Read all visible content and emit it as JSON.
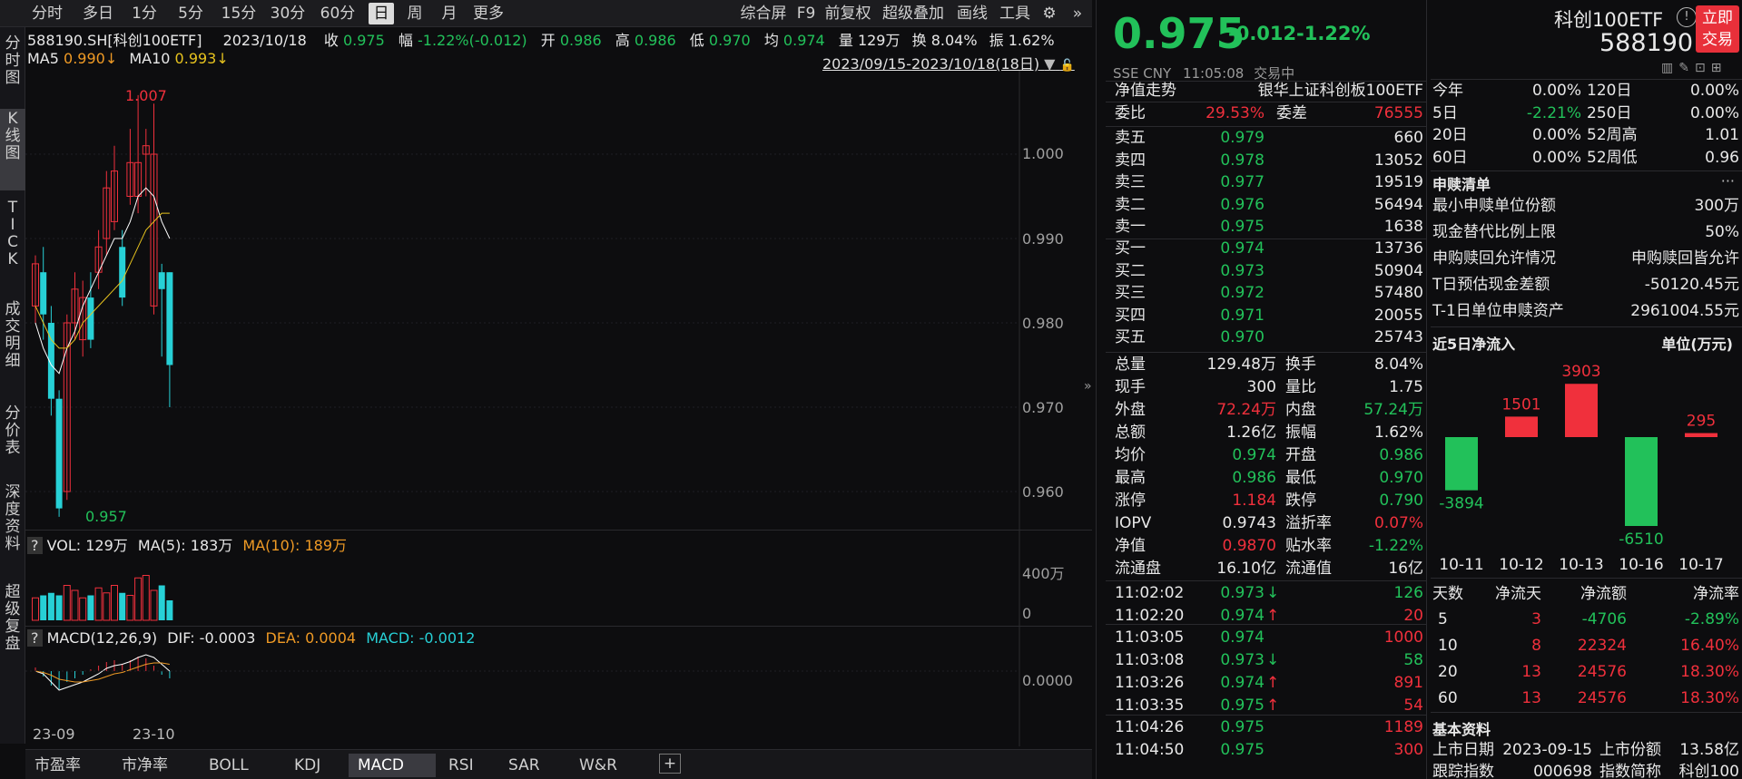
{
  "toolbar": {
    "left": [
      "分时",
      "多日",
      "1分",
      "5分",
      "15分",
      "30分",
      "60分",
      "日",
      "周",
      "月",
      "更多"
    ],
    "active": "日",
    "right": [
      "综合屏",
      "F9",
      "前复权",
      "超级叠加",
      "画线",
      "工具"
    ]
  },
  "sidetabs": [
    "分\n时\n图",
    "K\n线\n图",
    "T\nI\nC\nK",
    "成\n交\n明\n细",
    "分\n价\n表",
    "深\n度\n资\n料",
    "超\n级\n复\n盘"
  ],
  "info": {
    "code": "588190.SH[科创100ETF]",
    "date": "2023/10/18",
    "close_label": "收",
    "close": "0.975",
    "chg_label": "幅",
    "chg": "-1.22%(-0.012)",
    "open_label": "开",
    "open": "0.986",
    "high_label": "高",
    "high": "0.986",
    "low_label": "低",
    "low": "0.970",
    "avg_label": "均",
    "avg": "0.974",
    "vol_label": "量",
    "vol": "129万",
    "turn_label": "换",
    "turn": "8.04%",
    "amp_label": "振",
    "amp": "1.62%"
  },
  "ma": {
    "ma5_label": "MA5",
    "ma5": "0.990↓",
    "ma10_label": "MA10",
    "ma10": "0.993↓",
    "range": "2023/09/15-2023/10/18(18日)"
  },
  "yaxis": [
    "1.000",
    "0.990",
    "0.980",
    "0.970",
    "0.960"
  ],
  "annot": {
    "high": "1.007",
    "low": "0.957"
  },
  "vol": {
    "q": "?",
    "text": "VOL: 129万",
    "ma5": "MA(5): 183万",
    "ma10": "MA(10): 189万",
    "ticks": [
      "400万",
      "0"
    ]
  },
  "macd": {
    "q": "?",
    "title": "MACD(12,26,9)",
    "dif": "DIF: -0.0003",
    "dea": "DEA: 0.0004",
    "macd": "MACD: -0.0012",
    "tick": "0.0000"
  },
  "xaxis": [
    "23-09",
    "23-10"
  ],
  "bottomtabs": [
    "市盈率",
    "市净率",
    "BOLL",
    "KDJ",
    "MACD",
    "RSI",
    "SAR",
    "W&R"
  ],
  "bottom_active": "MACD",
  "quote": {
    "price": "0.975",
    "chg": "-0.012",
    "pct": "-1.22%",
    "name": "科创100ETF",
    "code": "588190",
    "buy_btn": "立即\n交易",
    "market": "SSE CNY",
    "time": "11:05:08",
    "status": "交易中"
  },
  "nav": {
    "label": "净值走势",
    "index": "银华上证科创板100ETF"
  },
  "wei": {
    "wb_label": "委比",
    "wb": "29.53%",
    "wc_label": "委差",
    "wc": "76555"
  },
  "asks": [
    {
      "l": "卖五",
      "p": "0.979",
      "v": "660"
    },
    {
      "l": "卖四",
      "p": "0.978",
      "v": "13052"
    },
    {
      "l": "卖三",
      "p": "0.977",
      "v": "19519"
    },
    {
      "l": "卖二",
      "p": "0.976",
      "v": "56494"
    },
    {
      "l": "卖一",
      "p": "0.975",
      "v": "1638"
    }
  ],
  "bids": [
    {
      "l": "买一",
      "p": "0.974",
      "v": "13736"
    },
    {
      "l": "买二",
      "p": "0.973",
      "v": "50904"
    },
    {
      "l": "买三",
      "p": "0.972",
      "v": "57480"
    },
    {
      "l": "买四",
      "p": "0.971",
      "v": "20055"
    },
    {
      "l": "买五",
      "p": "0.970",
      "v": "25743"
    }
  ],
  "stats": [
    {
      "a": "总量",
      "av": "129.48万",
      "ac": "wht",
      "b": "换手",
      "bv": "8.04%",
      "bc": "wht"
    },
    {
      "a": "现手",
      "av": "300",
      "ac": "wht",
      "b": "量比",
      "bv": "1.75",
      "bc": "wht"
    },
    {
      "a": "外盘",
      "av": "72.24万",
      "ac": "red",
      "b": "内盘",
      "bv": "57.24万",
      "bc": "green"
    },
    {
      "a": "总额",
      "av": "1.26亿",
      "ac": "wht",
      "b": "振幅",
      "bv": "1.62%",
      "bc": "wht"
    },
    {
      "a": "均价",
      "av": "0.974",
      "ac": "green",
      "b": "开盘",
      "bv": "0.986",
      "bc": "green"
    },
    {
      "a": "最高",
      "av": "0.986",
      "ac": "green",
      "b": "最低",
      "bv": "0.970",
      "bc": "green"
    },
    {
      "a": "涨停",
      "av": "1.184",
      "ac": "red",
      "b": "跌停",
      "bv": "0.790",
      "bc": "green"
    },
    {
      "a": "IOPV",
      "av": "0.9743",
      "ac": "wht",
      "b": "溢折率",
      "bv": "0.07%",
      "bc": "red"
    },
    {
      "a": "净值",
      "av": "0.9870",
      "ac": "red",
      "b": "贴水率",
      "bv": "-1.22%",
      "bc": "green"
    },
    {
      "a": "流通盘",
      "av": "16.10亿",
      "ac": "wht",
      "b": "流通值",
      "bv": "16亿",
      "bc": "wht"
    }
  ],
  "ticks": [
    {
      "t": "11:02:02",
      "p": "0.973",
      "pc": "green",
      "d": "↓",
      "dc": "green",
      "v": "126",
      "vc": "green"
    },
    {
      "t": "11:02:20",
      "p": "0.974",
      "pc": "green",
      "d": "↑",
      "dc": "red",
      "v": "20",
      "vc": "red"
    },
    {
      "t": "11:03:05",
      "p": "0.974",
      "pc": "green",
      "d": "",
      "dc": "",
      "v": "1000",
      "vc": "red"
    },
    {
      "t": "11:03:08",
      "p": "0.973",
      "pc": "green",
      "d": "↓",
      "dc": "green",
      "v": "58",
      "vc": "green"
    },
    {
      "t": "11:03:26",
      "p": "0.974",
      "pc": "green",
      "d": "↑",
      "dc": "red",
      "v": "891",
      "vc": "red"
    },
    {
      "t": "11:03:35",
      "p": "0.975",
      "pc": "green",
      "d": "↑",
      "dc": "red",
      "v": "54",
      "vc": "red"
    },
    {
      "t": "11:04:26",
      "p": "0.975",
      "pc": "green",
      "d": "",
      "dc": "",
      "v": "1189",
      "vc": "red"
    },
    {
      "t": "11:04:50",
      "p": "0.975",
      "pc": "green",
      "d": "",
      "dc": "",
      "v": "300",
      "vc": "red"
    }
  ],
  "perf": [
    {
      "a": "今年",
      "av": "0.00%",
      "ac": "wht",
      "b": "120日",
      "bv": "0.00%",
      "bc": "wht"
    },
    {
      "a": "5日",
      "av": "-2.21%",
      "ac": "green",
      "b": "250日",
      "bv": "0.00%",
      "bc": "wht"
    },
    {
      "a": "20日",
      "av": "0.00%",
      "ac": "wht",
      "b": "52周高",
      "bv": "1.01",
      "bc": "wht"
    },
    {
      "a": "60日",
      "av": "0.00%",
      "ac": "wht",
      "b": "52周低",
      "bv": "0.96",
      "bc": "wht"
    }
  ],
  "redeem": {
    "title": "申赎清单",
    "more": "···",
    "rows": [
      {
        "k": "最小申赎单位份额",
        "v": "300万"
      },
      {
        "k": "现金替代比例上限",
        "v": "50%"
      },
      {
        "k": "申购赎回允许情况",
        "v": "申购赎回皆允许"
      },
      {
        "k": "T日预估现金差额",
        "v": "-50120.45元"
      },
      {
        "k": "T-1日单位申赎资产",
        "v": "2961004.55元"
      }
    ]
  },
  "flow": {
    "title": "近5日净流入",
    "unit": "单位(万元)"
  },
  "chart_data": {
    "type": "bar",
    "categories": [
      "10-11",
      "10-12",
      "10-13",
      "10-16",
      "10-17"
    ],
    "values": [
      -3894,
      1501,
      3903,
      -6510,
      295
    ],
    "ylabel": "",
    "xlabel": "",
    "title": ""
  },
  "flowtable": {
    "headers": [
      "天数",
      "净流天",
      "净流额",
      "净流率"
    ],
    "rows": [
      [
        "5",
        "3",
        "-4706",
        "-2.89%"
      ],
      [
        "10",
        "8",
        "22324",
        "16.40%"
      ],
      [
        "20",
        "13",
        "24576",
        "18.30%"
      ],
      [
        "60",
        "13",
        "24576",
        "18.30%"
      ]
    ]
  },
  "basic": {
    "title": "基本资料",
    "r1": {
      "a": "上市日期",
      "av": "2023-09-15",
      "b": "上市份额",
      "bv": "13.58亿"
    },
    "r2": {
      "a": "跟踪指数",
      "av": "000698",
      "b": "指数简称",
      "bv": "科创100"
    }
  },
  "colors": {
    "up": "#f0303c",
    "down": "#27d0d6",
    "ma5": "#ffffff",
    "ma10": "#e6c21e",
    "green": "#22c15a"
  }
}
